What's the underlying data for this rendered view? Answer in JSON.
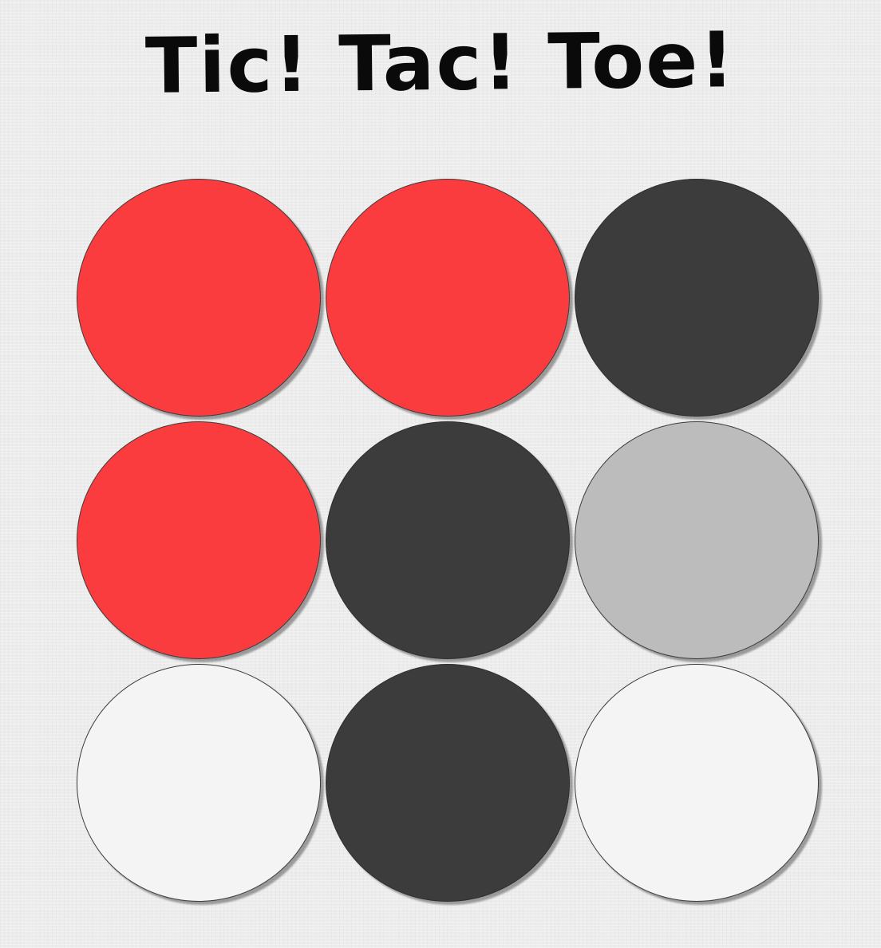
{
  "title": "Tic! Tac! Toe!",
  "colors": {
    "red": "#fa3c3e",
    "dark": "#3c3c3c",
    "empty": "#f4f4f4",
    "hover": "#bcbcbc",
    "background": "#ececec"
  },
  "board": [
    [
      "red",
      "red",
      "dark"
    ],
    [
      "red",
      "dark",
      "hover"
    ],
    [
      "empty",
      "dark",
      "empty"
    ]
  ]
}
